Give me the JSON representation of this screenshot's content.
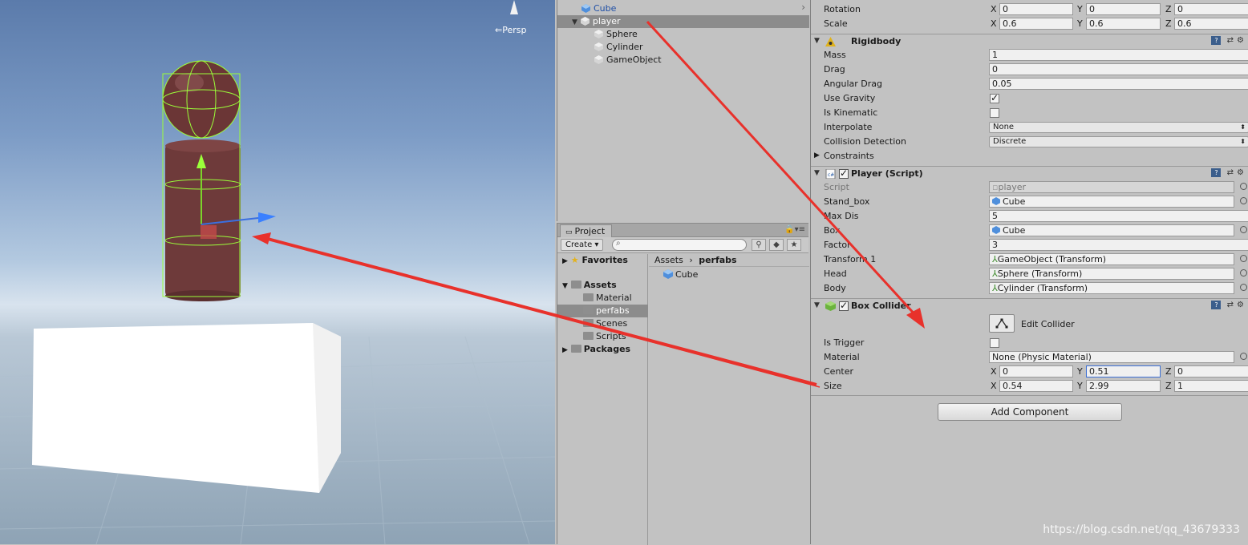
{
  "scene": {
    "persp_label": "Persp"
  },
  "hierarchy": {
    "items": [
      {
        "label": "Cube"
      },
      {
        "label": "player"
      },
      {
        "label": "Sphere"
      },
      {
        "label": "Cylinder"
      },
      {
        "label": "GameObject"
      }
    ]
  },
  "project": {
    "tab_label": "Project",
    "create_label": "Create",
    "favorites_label": "Favorites",
    "assets_label": "Assets",
    "folders": [
      "Material",
      "perfabs",
      "Scenes",
      "Scripts"
    ],
    "packages_label": "Packages",
    "breadcrumb": {
      "root": "Assets",
      "current": "perfabs"
    },
    "files": [
      "Cube"
    ]
  },
  "inspector": {
    "transform": {
      "rotation_label": "Rotation",
      "rotation": {
        "x": "0",
        "y": "0",
        "z": "0"
      },
      "scale_label": "Scale",
      "scale": {
        "x": "0.6",
        "y": "0.6",
        "z": "0.6"
      }
    },
    "rigidbody": {
      "title": "Rigidbody",
      "mass_label": "Mass",
      "mass": "1",
      "drag_label": "Drag",
      "drag": "0",
      "angular_drag_label": "Angular Drag",
      "angular_drag": "0.05",
      "use_gravity_label": "Use Gravity",
      "use_gravity": true,
      "is_kinematic_label": "Is Kinematic",
      "is_kinematic": false,
      "interpolate_label": "Interpolate",
      "interpolate": "None",
      "collision_label": "Collision Detection",
      "collision": "Discrete",
      "constraints_label": "Constraints"
    },
    "player_script": {
      "title": "Player (Script)",
      "script_label": "Script",
      "script": "player",
      "stand_box_label": "Stand_box",
      "stand_box": "Cube",
      "max_dis_label": "Max Dis",
      "max_dis": "5",
      "box_label": "Box",
      "box": "Cube",
      "factor_label": "Factor",
      "factor": "3",
      "transform1_label": "Transform 1",
      "transform1": "GameObject (Transform)",
      "head_label": "Head",
      "head": "Sphere (Transform)",
      "body_label": "Body",
      "body": "Cylinder (Transform)"
    },
    "box_collider": {
      "title": "Box Collider",
      "edit_collider_label": "Edit Collider",
      "is_trigger_label": "Is Trigger",
      "is_trigger": false,
      "material_label": "Material",
      "material": "None (Physic Material)",
      "center_label": "Center",
      "center": {
        "x": "0",
        "y": "0.51",
        "z": "0"
      },
      "size_label": "Size",
      "size": {
        "x": "0.54",
        "y": "2.99",
        "z": "1"
      }
    },
    "add_component_label": "Add Component"
  },
  "watermark": "https://blog.csdn.net/qq_43679333",
  "colors": {
    "selection": "#8c8c8c",
    "annotation_arrow": "#e8312b",
    "panel_bg": "#c2c2c2"
  }
}
